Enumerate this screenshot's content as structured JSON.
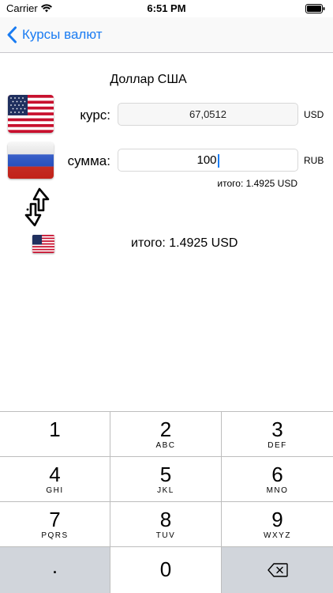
{
  "status_bar": {
    "carrier": "Carrier",
    "time": "6:51 PM"
  },
  "nav": {
    "back_label": "Курсы валют"
  },
  "converter": {
    "currency_name": "Доллар США",
    "rate_label": "курс:",
    "rate_value": "67,0512",
    "rate_unit": "USD",
    "amount_label": "сумма:",
    "amount_value": "100",
    "amount_unit": "RUB",
    "inline_total": "итого: 1.4925 USD",
    "total": "итого: 1.4925 USD"
  },
  "keypad": {
    "keys": [
      {
        "number": "1",
        "letters": ""
      },
      {
        "number": "2",
        "letters": "ABC"
      },
      {
        "number": "3",
        "letters": "DEF"
      },
      {
        "number": "4",
        "letters": "GHI"
      },
      {
        "number": "5",
        "letters": "JKL"
      },
      {
        "number": "6",
        "letters": "MNO"
      },
      {
        "number": "7",
        "letters": "PQRS"
      },
      {
        "number": "8",
        "letters": "TUV"
      },
      {
        "number": "9",
        "letters": "WXYZ"
      }
    ],
    "decimal": ".",
    "zero": "0"
  },
  "colors": {
    "accent": "#1a7cf2",
    "keypad_dark": "#d1d5db",
    "separator": "#bdbdbd"
  },
  "icons": [
    "wifi-icon",
    "battery-icon",
    "back-chevron-icon",
    "us-flag-icon",
    "ru-flag-icon",
    "swap-arrows-icon",
    "delete-icon"
  ]
}
